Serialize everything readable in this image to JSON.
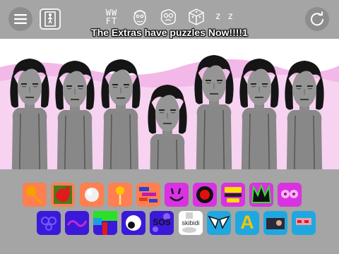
{
  "toolbar": {
    "menu_icon": "hamburger-icon",
    "exit_icon": "exit-door-icon",
    "reset_icon": "reset-icon",
    "modes": [
      {
        "id": "wwft",
        "label_top": "WW",
        "label_bottom": "FT"
      },
      {
        "id": "face",
        "icon": "scribbled-face-icon"
      },
      {
        "id": "blob",
        "icon": "blob-face-icon"
      },
      {
        "id": "cube",
        "icon": "cube-icon"
      },
      {
        "id": "zz",
        "label": "z z"
      }
    ]
  },
  "banner": {
    "text": "The Extras have puzzles Now!!!!1"
  },
  "stage": {
    "background": "#ffffff",
    "hill_color": "#f2b8e8",
    "character_count": 7
  },
  "sounds": {
    "row1": [
      {
        "name": "orange-pin",
        "bg": "#ff7f50"
      },
      {
        "name": "red-splatter",
        "bg": "#ff7f50"
      },
      {
        "name": "pearl",
        "bg": "#ff7f50"
      },
      {
        "name": "orange-lollipop",
        "bg": "#ff7f50"
      },
      {
        "name": "scribble",
        "bg": "#ff7f50"
      },
      {
        "name": "smile-face",
        "bg": "#d932e0"
      },
      {
        "name": "red-orb",
        "bg": "#d932e0"
      },
      {
        "name": "yellow-visor",
        "bg": "#d932e0"
      },
      {
        "name": "green-crown",
        "bg": "#d932e0"
      },
      {
        "name": "pink-eyes",
        "bg": "#d932e0"
      }
    ],
    "row2": [
      {
        "name": "blue-dots",
        "bg": "#3b19d8"
      },
      {
        "name": "blue-wave",
        "bg": "#3b19d8"
      },
      {
        "name": "green-red-shape",
        "bg": "#3b19d8"
      },
      {
        "name": "eyeball",
        "bg": "#3b19d8"
      },
      {
        "name": "sos",
        "bg": "#3b19d8",
        "label": "SOS"
      },
      {
        "name": "skibidi",
        "bg": "#ffffff",
        "label": "skibidi"
      },
      {
        "name": "white-eyes",
        "bg": "#1fa8e0"
      },
      {
        "name": "letter-a",
        "bg": "#1fa8e0",
        "label": "A"
      },
      {
        "name": "photo",
        "bg": "#1fa8e0"
      },
      {
        "name": "red-blocks",
        "bg": "#1fa8e0"
      }
    ]
  }
}
